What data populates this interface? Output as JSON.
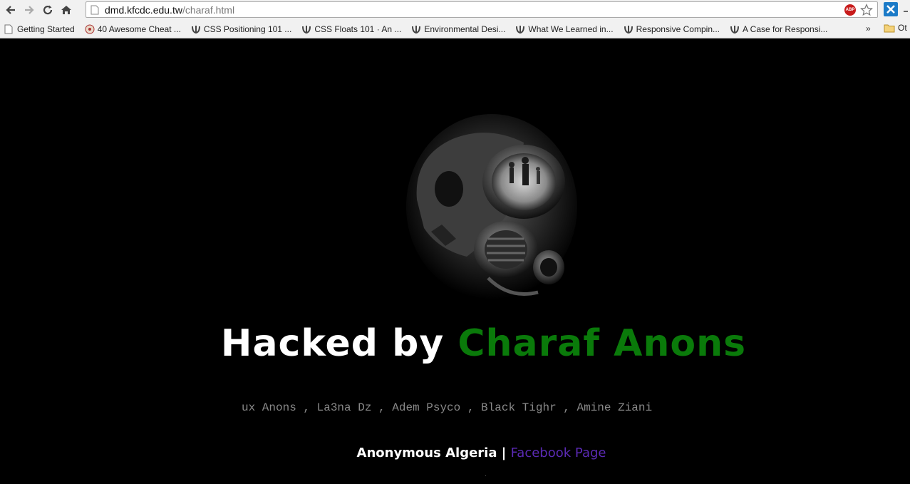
{
  "browser": {
    "url_domain": "dmd.kfcdc.edu.tw",
    "url_path": "/charaf.html",
    "adblock_badge": "ABP",
    "bookmarks": [
      {
        "label": "Getting Started",
        "icon": "page-icon"
      },
      {
        "label": "40 Awesome Cheat ...",
        "icon": "site-favicon"
      },
      {
        "label": "CSS Positioning 101 ...",
        "icon": "laurel-favicon"
      },
      {
        "label": "CSS Floats 101 · An ...",
        "icon": "laurel-favicon"
      },
      {
        "label": "Environmental Desi...",
        "icon": "laurel-favicon"
      },
      {
        "label": "What We Learned in...",
        "icon": "laurel-favicon"
      },
      {
        "label": "Responsive Compin...",
        "icon": "laurel-favicon"
      },
      {
        "label": "A Case for Responsi...",
        "icon": "laurel-favicon"
      }
    ],
    "bookmarks_overflow": "»",
    "other_bookmarks": "Ot"
  },
  "page": {
    "headline_white": "Hacked by ",
    "headline_green": "Charaf Anons",
    "crew": "ux Anons , La3na Dz , Adem Psyco , Black Tighr , Amine Ziani",
    "team": "Anonymous Algeria",
    "separator": " | ",
    "facebook_link": "Facebook Page"
  },
  "colors": {
    "background": "#000000",
    "headline_green": "#0a7a0a",
    "link_purple": "#5b2ab5",
    "crew_gray": "#8a8a8a"
  }
}
